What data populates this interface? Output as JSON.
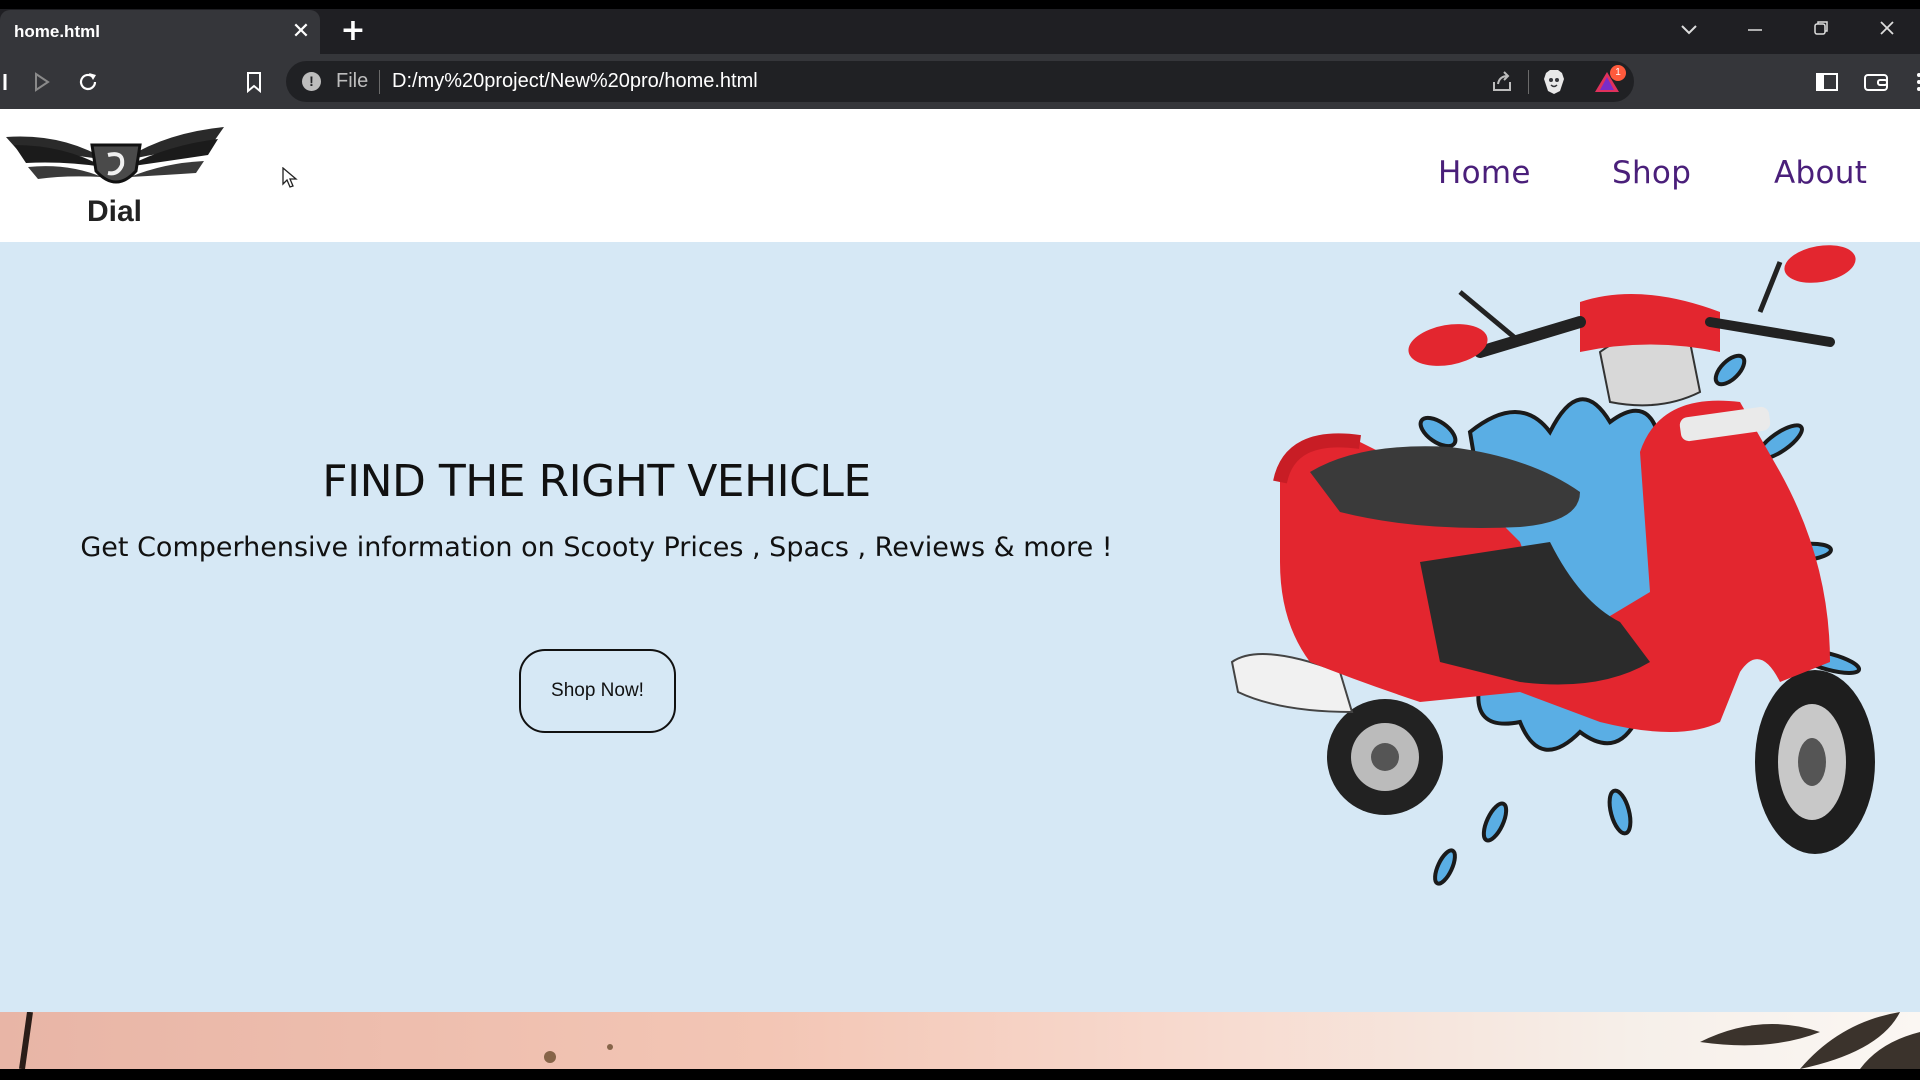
{
  "browser": {
    "tab": {
      "title": "home.html",
      "close_glyph": "✕"
    },
    "new_tab_glyph": "+",
    "omnibox": {
      "info_glyph": "!",
      "scheme_label": "File",
      "url": "D:/my%20project/New%20pro/home.html"
    },
    "extension_badge_count": "1"
  },
  "site": {
    "logo_text": "Dial",
    "nav": [
      {
        "label": "Home"
      },
      {
        "label": "Shop"
      },
      {
        "label": "About"
      }
    ],
    "hero": {
      "title": "FIND THE RIGHT VEHICLE",
      "subtitle": "Get Comperhensive information on Scooty Prices , Spacs , Reviews & more !",
      "cta_label": "Shop Now!"
    }
  },
  "colors": {
    "nav_text": "#4a1f7a",
    "hero_bg": "#d6e8f5",
    "scooter_red": "#e3262f",
    "splash_blue": "#5aaee4"
  }
}
